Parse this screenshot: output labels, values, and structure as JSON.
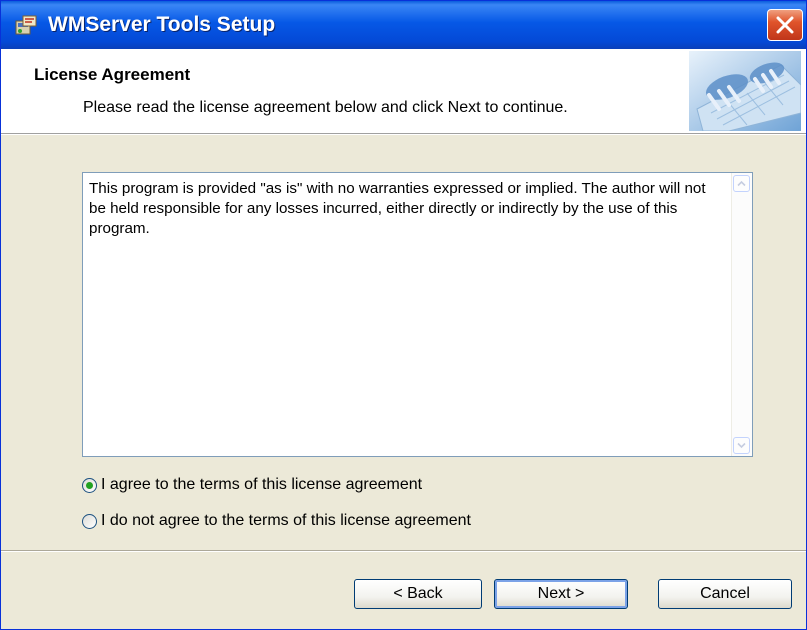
{
  "window": {
    "title": "WMServer Tools Setup",
    "title_icon": "setup-icon",
    "close_icon": "close-icon"
  },
  "header": {
    "title": "License Agreement",
    "description": "Please read the license agreement below and click Next to continue.",
    "image": "keyboard-hands-image"
  },
  "license": {
    "text": "This program is provided \"as is\" with no warranties expressed or implied. The author will  not be held responsible for any losses incurred, either directly or indirectly by the use of this program."
  },
  "options": [
    {
      "label": "I agree to the terms of this license agreement",
      "selected": true
    },
    {
      "label": "I do not agree to the terms of this license agreement",
      "selected": false
    }
  ],
  "buttons": {
    "back": "< Back",
    "next": "Next >",
    "cancel": "Cancel"
  },
  "colors": {
    "titlebar": "#0658e6",
    "dialog_bg": "#ece9d8",
    "radio_selected": "#21a121"
  }
}
